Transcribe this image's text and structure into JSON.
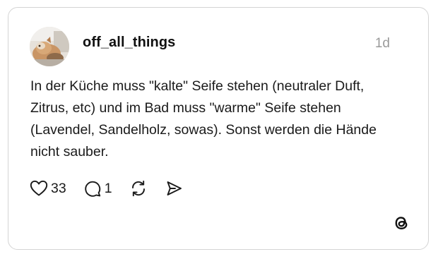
{
  "post": {
    "username": "off_all_things",
    "timestamp": "1d",
    "text": "In der Küche muss \"kalte\" Seife stehen (neutraler Duft, Zitrus, etc) und im Bad muss \"warme\" Seife stehen (Lavendel, Sandelholz, sowas). Sonst werden die Hände nicht sauber.",
    "avatar_alt": "profile picture"
  },
  "actions": {
    "likes": "33",
    "replies": "1",
    "icons": [
      "heart-icon",
      "comment-icon",
      "repost-icon",
      "share-icon"
    ]
  },
  "brand": {
    "logo_icon": "threads-logo-icon",
    "text_color": "#1a1a1a",
    "muted_color": "#9a9a9a",
    "border_color": "#d4d4d4"
  }
}
